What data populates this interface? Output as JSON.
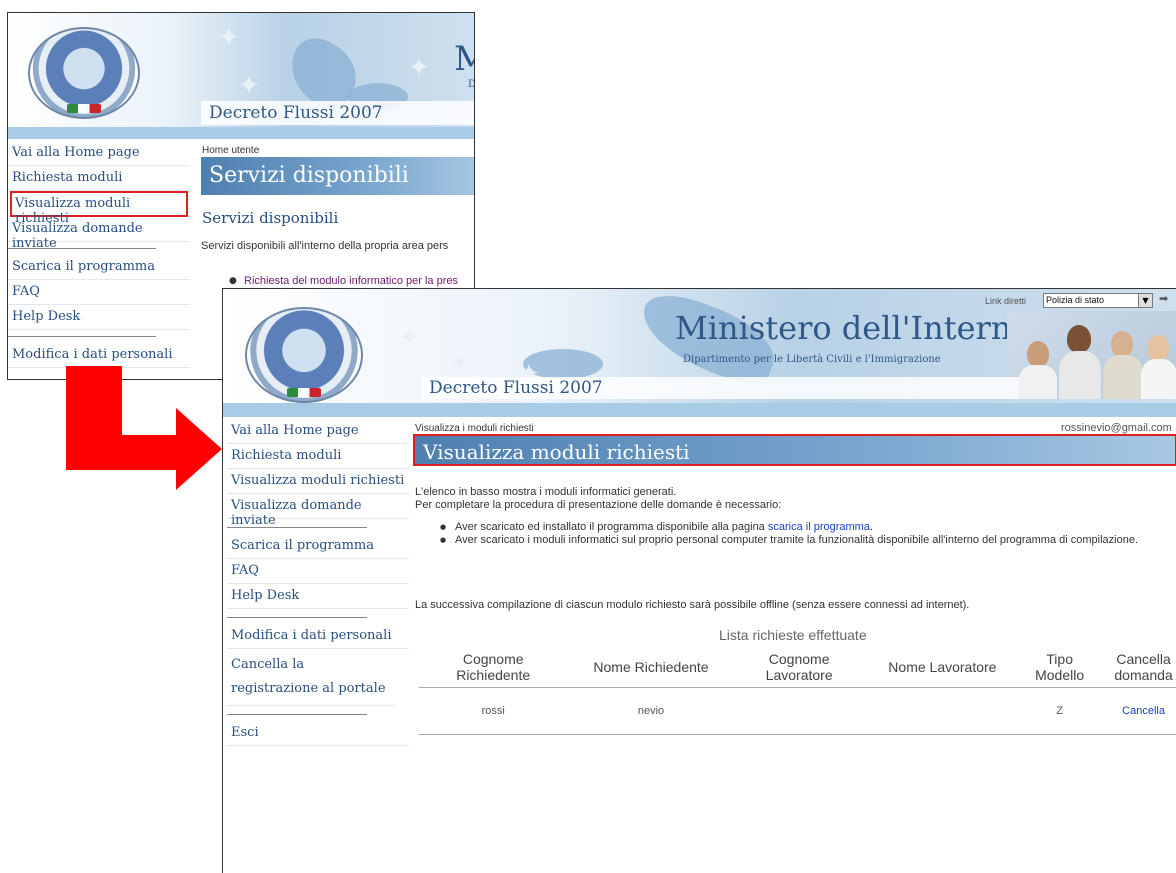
{
  "back_window": {
    "decreto": "Decreto Flussi 2007",
    "ministero_partial": "M",
    "ministero_sub_partial": "D",
    "sidebar": {
      "items": [
        "Vai alla Home page",
        "Richiesta moduli",
        "Visualizza moduli richiesti",
        "Visualizza domande inviate"
      ],
      "items2": [
        "Scarica il programma",
        "FAQ",
        "Help Desk"
      ],
      "items3": [
        "Modifica i dati personali"
      ]
    },
    "breadcrumb": "Home utente",
    "page_title": "Servizi disponibili",
    "section_title": "Servizi disponibili",
    "intro": "Servizi disponibili all'interno della propria area pers",
    "bullet": "Richiesta del modulo informatico per la pres"
  },
  "front_window": {
    "link_diretti_label": "Link diretti",
    "link_diretti_value": "Polizia di stato",
    "ministero": "Ministero dell'Interno",
    "dipartimento": "Dipartimento per le Libertà Civili e l'Immigrazione",
    "decreto": "Decreto Flussi 2007",
    "sidebar": {
      "items": [
        "Vai alla Home page",
        "Richiesta moduli",
        "Visualizza moduli richiesti",
        "Visualizza domande inviate"
      ],
      "items2": [
        "Scarica il programma",
        "FAQ",
        "Help Desk"
      ],
      "items3": [
        "Modifica i dati personali",
        "Cancella la registrazione al portale"
      ],
      "items4": [
        "Esci"
      ]
    },
    "breadcrumb": "Visualizza i moduli richiesti",
    "user_email": "rossinevio@gmail.com",
    "page_title": "Visualizza moduli richiesti",
    "intro_line1": "L'elenco in basso mostra i moduli informatici generati.",
    "intro_line2": "Per completare la procedura di presentazione delle domande è necessario:",
    "bullet1_text": "Aver scaricato ed installato il programma disponibile alla pagina ",
    "bullet1_link": "scarica il programma",
    "bullet1_end": ".",
    "bullet2_text": "Aver scaricato i moduli informatici sul proprio personal computer tramite la funzionalità disponibile all'interno del programma di compilazione.",
    "offline_note": "La successiva compilazione di ciascun modulo richiesto sarà possibile offline (senza essere connessi ad internet).",
    "table": {
      "caption": "Lista richieste effettuate",
      "headers": [
        "Cognome Richiedente",
        "Nome Richiedente",
        "Cognome Lavoratore",
        "Nome Lavoratore",
        "Tipo Modello",
        "Cancella domanda"
      ],
      "rows": [
        {
          "cognome_richiedente": "rossi",
          "nome_richiedente": "nevio",
          "cognome_lavoratore": "",
          "nome_lavoratore": "",
          "tipo_modello": "Z",
          "cancella": "Cancella"
        }
      ]
    }
  },
  "colors": {
    "highlight_border": "#e02020",
    "arrow": "#ff0000",
    "title_bar": "#4d7fb0",
    "nav_text": "#284e80",
    "link": "#1a3fbf"
  }
}
